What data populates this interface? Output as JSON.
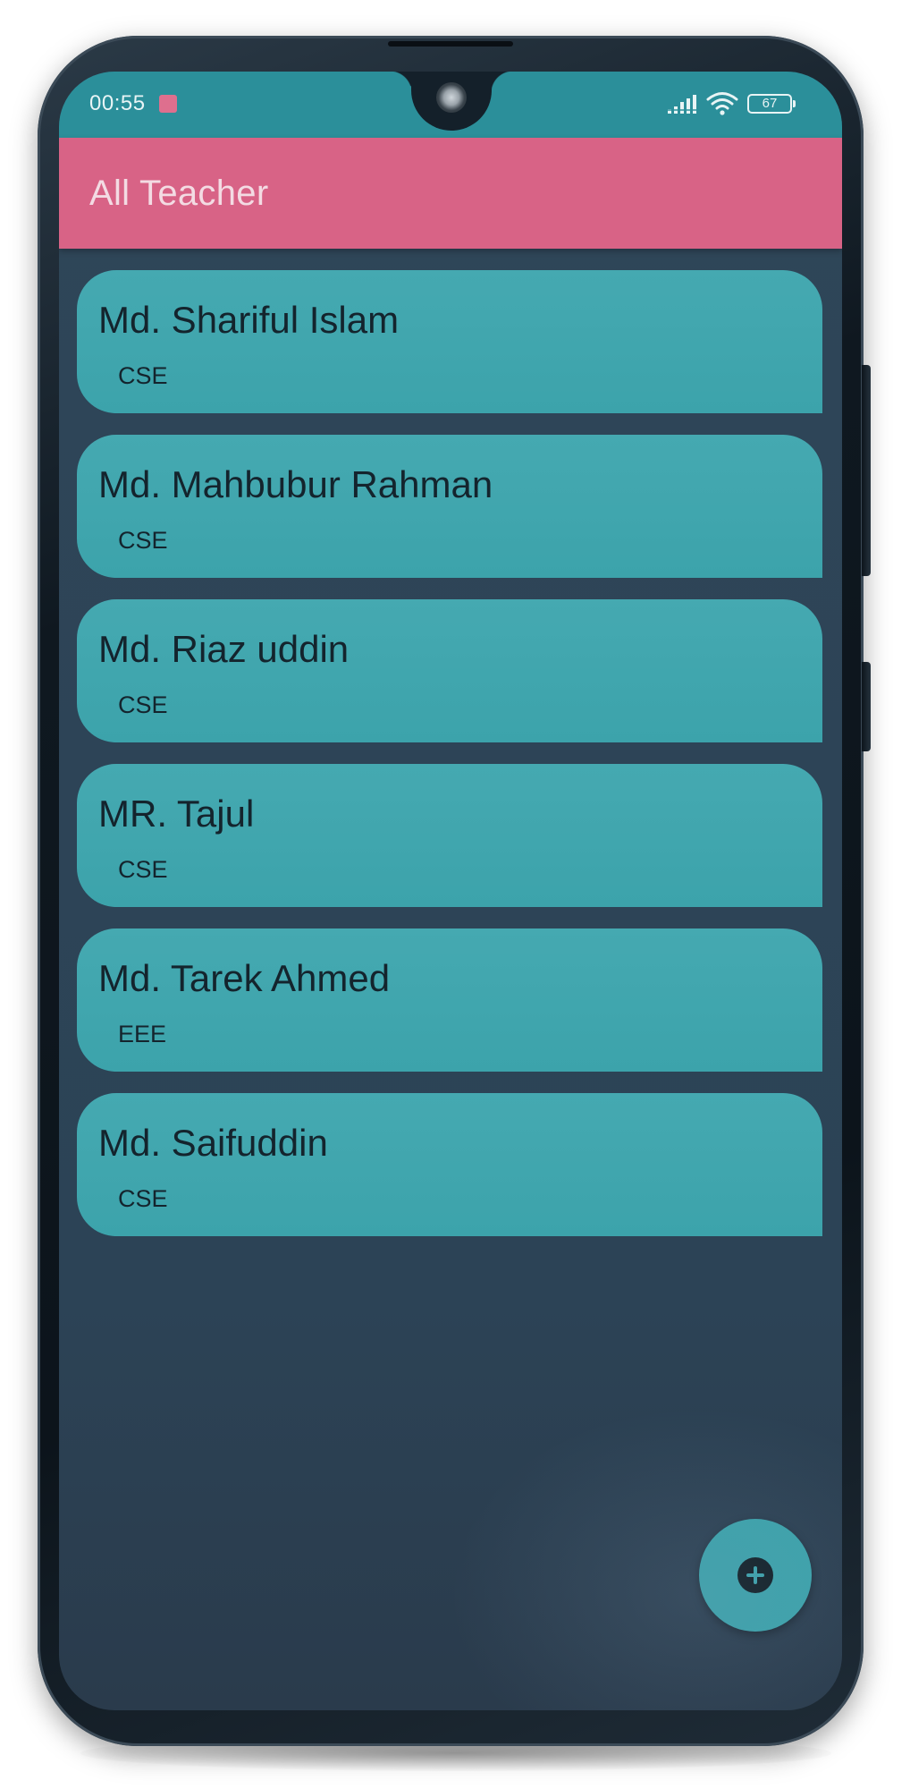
{
  "status_bar": {
    "time": "00:55",
    "battery": "67",
    "icons": [
      "notification-icon",
      "signal-icon",
      "wifi-icon",
      "battery-icon"
    ]
  },
  "app_bar": {
    "title": "All Teacher"
  },
  "teachers": [
    {
      "name": "Md. Shariful Islam",
      "department": "CSE"
    },
    {
      "name": "Md. Mahbubur Rahman",
      "department": "CSE"
    },
    {
      "name": "Md. Riaz uddin",
      "department": "CSE"
    },
    {
      "name": "MR. Tajul",
      "department": "CSE"
    },
    {
      "name": "Md. Tarek Ahmed",
      "department": "EEE"
    },
    {
      "name": "Md. Saifuddin",
      "department": "CSE"
    }
  ],
  "fab": {
    "icon": "add-icon"
  },
  "colors": {
    "status_bar": "#2b8f9a",
    "app_bar": "#d86386",
    "card": "#3ea5ad",
    "background": "#2d4457",
    "fab": "#3ba3ab"
  }
}
